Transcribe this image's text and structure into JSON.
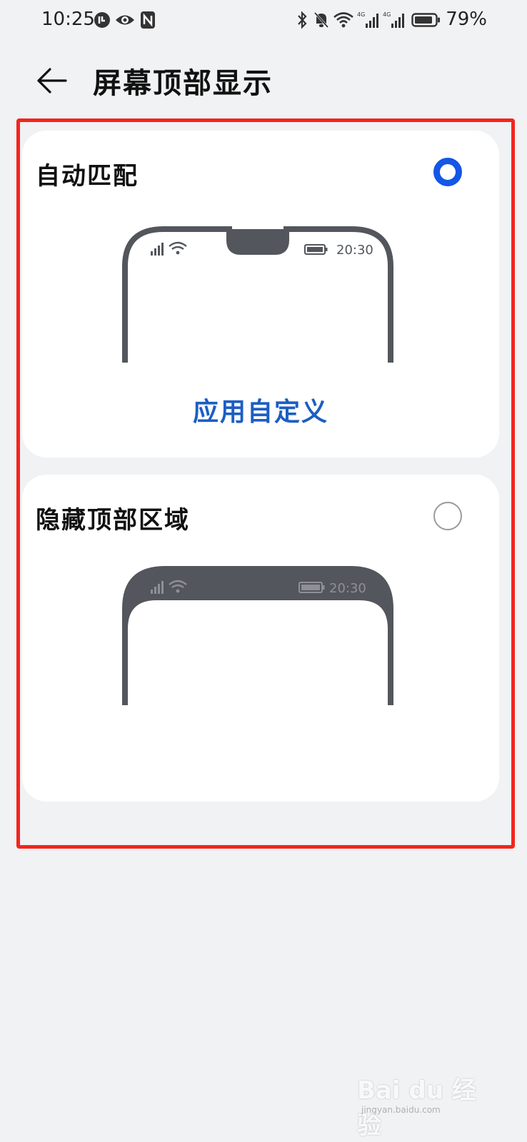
{
  "status_bar": {
    "time": "10:25",
    "battery_percent": "79%",
    "network_labels": [
      "4G",
      "4G"
    ],
    "icons": [
      "screen-time-icon",
      "eye-comfort-icon",
      "nfc-icon",
      "bluetooth-icon",
      "mute-bell-icon",
      "wifi-icon",
      "signal-icon",
      "signal-icon",
      "battery-icon"
    ]
  },
  "header": {
    "back_icon": "arrow-left-icon",
    "title": "屏幕顶部显示"
  },
  "options": [
    {
      "label": "自动匹配",
      "selected": true,
      "preview_time": "20:30",
      "link": "应用自定义"
    },
    {
      "label": "隐藏顶部区域",
      "selected": false,
      "preview_time": "20:30"
    }
  ],
  "watermark": {
    "text": "Bai du 经验",
    "sub": "jingyan.baidu.com"
  },
  "colors": {
    "accent": "#1456e6",
    "link": "#1c5ec4",
    "highlight": "#f3251d",
    "background": "#f1f2f4",
    "card": "#ffffff",
    "phone_frame": "#53565c"
  }
}
